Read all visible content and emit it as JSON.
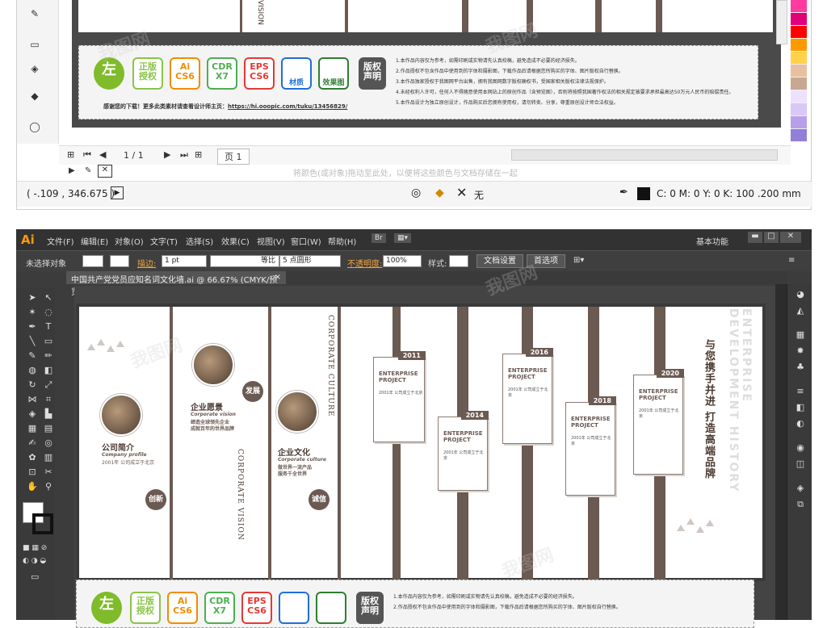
{
  "top_window": {
    "coords": "( -.109 , 346.675 )",
    "page_counter": "1 / 1",
    "page_tab": "页 1",
    "fill_label": "无",
    "stroke_info": "C: 0 M: 0 Y: 0 K: 100  .200 mm",
    "hint_text": "将颜色(或对象)拖动至此处，以便将这些颜色与文档存储在一起",
    "palette_colors": [
      "#ff3aa0",
      "#e00078",
      "#ff0000",
      "#ff9900",
      "#ffd24a",
      "#e8c0a0",
      "#c8a890",
      "#f0e0ff",
      "#d8c8f8",
      "#b8a0e8",
      "#9080d8"
    ],
    "banner": {
      "logos": [
        {
          "label": "左",
          "color": "#7fbb2a",
          "style": "circle"
        },
        {
          "label": "正版\n授权",
          "color": "#8bc34a"
        },
        {
          "label": "Ai\nCS6",
          "color": "#f28c00"
        },
        {
          "label": "CDR\nX7",
          "color": "#4caf50"
        },
        {
          "label": "EPS\nCS6",
          "color": "#e53935"
        },
        {
          "label": "材质",
          "color": "#1e6fd9"
        },
        {
          "label": "效果图",
          "color": "#2e7d32"
        }
      ],
      "copyright_label": "版权\n声明",
      "legal_lines": [
        "1.本作品内容仅为参考，如需印刷或实物请先认真校稿，避免造成不必要的经济损失。",
        "2.作品授权不包含作品中使用到的字体和摄影图，下载作品后请根据您所购买的字体、图片版权自行替换。",
        "3.本作品独家授权于我图网平台出售，拥有我图网数字版权确权书，受国家相关版权法律法规保护。",
        "4.未经权利人许可，任何人不得随意使用本网站上的原创作品（含预览图），否则将按照我国著作权法的相关规定被要求承担最高达50万元人民币的赔偿责任。",
        "5.本作品设计为独立原创设计，作品购买后您拥有使用权，请勿转卖、分享，尊重原创设计师合法权益。"
      ],
      "thanks_text": "感谢您的下载！更多此类素材请查看设计师主页：",
      "designer_link": "https://hi.ooopic.com/tuku/13456829/"
    }
  },
  "ai_window": {
    "logo": "Ai",
    "menus": [
      "文件(F)",
      "编辑(E)",
      "对象(O)",
      "文字(T)",
      "选择(S)",
      "效果(C)",
      "视图(V)",
      "窗口(W)",
      "帮助(H)"
    ],
    "workspace": "基本功能",
    "control": {
      "no_selection": "未选择对象",
      "stroke_label": "描边:",
      "stroke_value": "1 pt",
      "line_style": "等比",
      "brush": "5 点圆形",
      "opacity_label": "不透明度:",
      "opacity_value": "100%",
      "style_label": "样式:",
      "doc_settings": "文档设置",
      "preferences": "首选项"
    },
    "doc_tab": "中国共产党党员应知名词文化墙.ai @ 66.67% (CMYK/预览)",
    "artboard": {
      "company_profile": {
        "cn": "公司简介",
        "en": "Company profile",
        "desc": "2001年 公司成立于北京"
      },
      "vision": {
        "cn": "企业愿景",
        "en": "Corporate vision",
        "desc": "缔造全球领先企业\n成就百年的世界品牌"
      },
      "culture": {
        "cn": "企业文化",
        "en": "Corporate culture",
        "desc": "做世界一流产品\n服务千全世界"
      },
      "nodes": {
        "innovation": "创新",
        "development": "发展",
        "integrity": "诚信"
      },
      "vert_culture_en": "CORPORATE CULTURE",
      "vert_vision_en": "CORPORATE VISION",
      "slogan": "与您携手并进 打造高端品牌",
      "history_en": "ENTERPRISE DEVELOPMENT HISTORY",
      "timeline": [
        {
          "year": "2011",
          "title": "ENTERPRISE\nPROJECT",
          "desc": "2001年 公司成立于北京"
        },
        {
          "year": "2014",
          "title": "ENTERPRISE\nPROJECT",
          "desc": "2001年 公司成立于北京"
        },
        {
          "year": "2016",
          "title": "ENTERPRISE\nPROJECT",
          "desc": "2001年 公司成立于北京"
        },
        {
          "year": "2018",
          "title": "ENTERPRISE\nPROJECT",
          "desc": "2001年 公司成立于北京"
        },
        {
          "year": "2020",
          "title": "ENTERPRISE\nPROJECT",
          "desc": "2001年 公司成立于北京"
        }
      ]
    }
  }
}
